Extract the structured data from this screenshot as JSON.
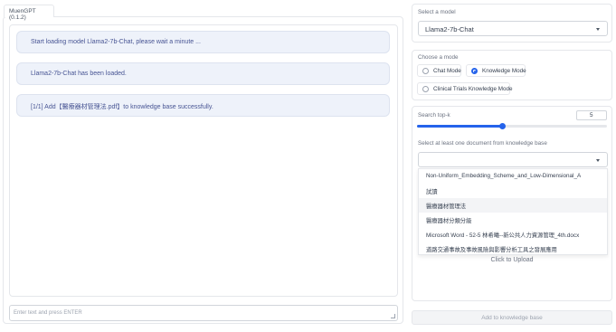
{
  "tab": {
    "label": "MuenGPT (0.1.2)"
  },
  "chat": {
    "messages": [
      "Start loading model Llama2-7b-Chat, please wait a minute ...",
      "Llama2-7b-Chat has been loaded.",
      "[1/1] Add【醫療器材管理法.pdf】to knowledge base successfully."
    ],
    "input_placeholder": "Enter text and press ENTER"
  },
  "model": {
    "label": "Select a model",
    "value": "Llama2-7b-Chat"
  },
  "mode": {
    "label": "Choose a mode",
    "options": [
      "Chat Mode",
      "Knowledge Mode",
      "Clinical Trials Knowledge Mode"
    ],
    "selected": "Knowledge Mode"
  },
  "topk": {
    "label": "Search top-k",
    "value": "5",
    "fill_fraction": 0.45
  },
  "documents": {
    "label": "Select at least one document from knowledge base",
    "options": [
      "Non-Uniform_Embedding_Scheme_and_Low-Dimensional_A",
      "試讀",
      "醫療器材管理法",
      "醫療器材分類分級",
      "Microsoft Word - 52-5 林希曦--新公共人力資源管理_4th.docx",
      "道路交通事故及事故風險與影響分析工具之發展應用"
    ],
    "highlighted_index": 2
  },
  "upload": {
    "label": "Click to Upload"
  },
  "add_button": {
    "label": "Add to knowledge base"
  },
  "colors": {
    "accent": "#2563eb",
    "message_bg": "#eef2fa",
    "message_text": "#475493"
  }
}
